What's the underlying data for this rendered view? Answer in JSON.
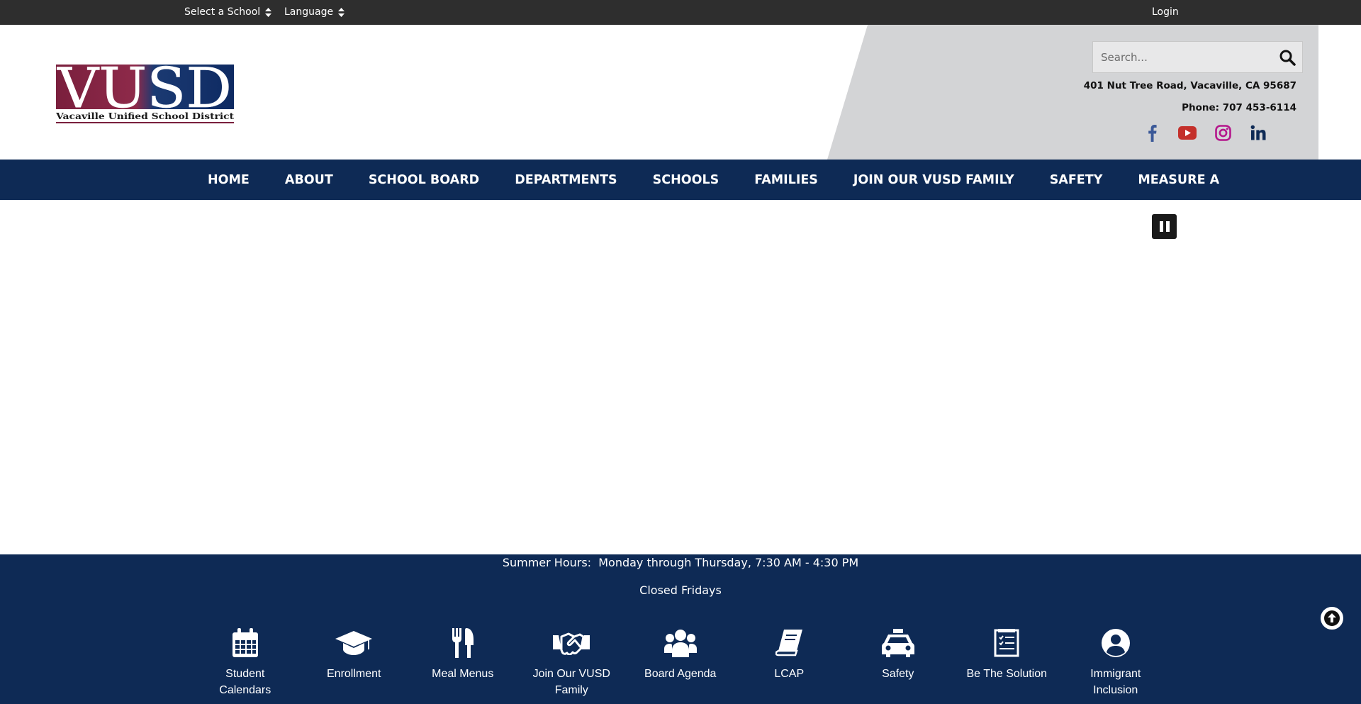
{
  "topbar": {
    "school_select": "Select a School",
    "language_select": "Language",
    "login": "Login"
  },
  "header": {
    "logo_text": "VUSD",
    "logo_subtitle": "Vacaville Unified School District",
    "search_placeholder": "Search...",
    "address": "401 Nut Tree Road, Vacaville, CA 95687",
    "phone": "Phone: 707 453-6114",
    "social": [
      "facebook-icon",
      "youtube-icon",
      "instagram-icon",
      "linkedin-icon"
    ],
    "colors": {
      "panel": "#d3d4d6",
      "facebook": "#3b5998",
      "youtube": "#c4302b",
      "instagram": "#b5178c",
      "linkedin": "#0e2a55"
    }
  },
  "nav": {
    "items": [
      "HOME",
      "ABOUT",
      "SCHOOL BOARD",
      "DEPARTMENTS",
      "SCHOOLS",
      "FAMILIES",
      "JOIN OUR VUSD FAMILY",
      "SAFETY",
      "MEASURE A"
    ],
    "background": "#0e2a55"
  },
  "footer": {
    "hours": "Summer Hours:  Monday through Thursday, 7:30 AM - 4:30 PM",
    "closed": "Closed Fridays",
    "quick_links": [
      {
        "label": "Student Calendars",
        "icon": "calendar-icon"
      },
      {
        "label": "Enrollment",
        "icon": "graduation-cap-icon"
      },
      {
        "label": "Meal Menus",
        "icon": "utensils-icon"
      },
      {
        "label": "Join Our VUSD Family",
        "icon": "handshake-icon"
      },
      {
        "label": "Board Agenda",
        "icon": "users-icon"
      },
      {
        "label": "LCAP",
        "icon": "book-icon"
      },
      {
        "label": "Safety",
        "icon": "taxi-icon"
      },
      {
        "label": "Be The Solution",
        "icon": "checklist-icon"
      },
      {
        "label": "Immigrant Inclusion",
        "icon": "user-circle-icon"
      }
    ]
  }
}
